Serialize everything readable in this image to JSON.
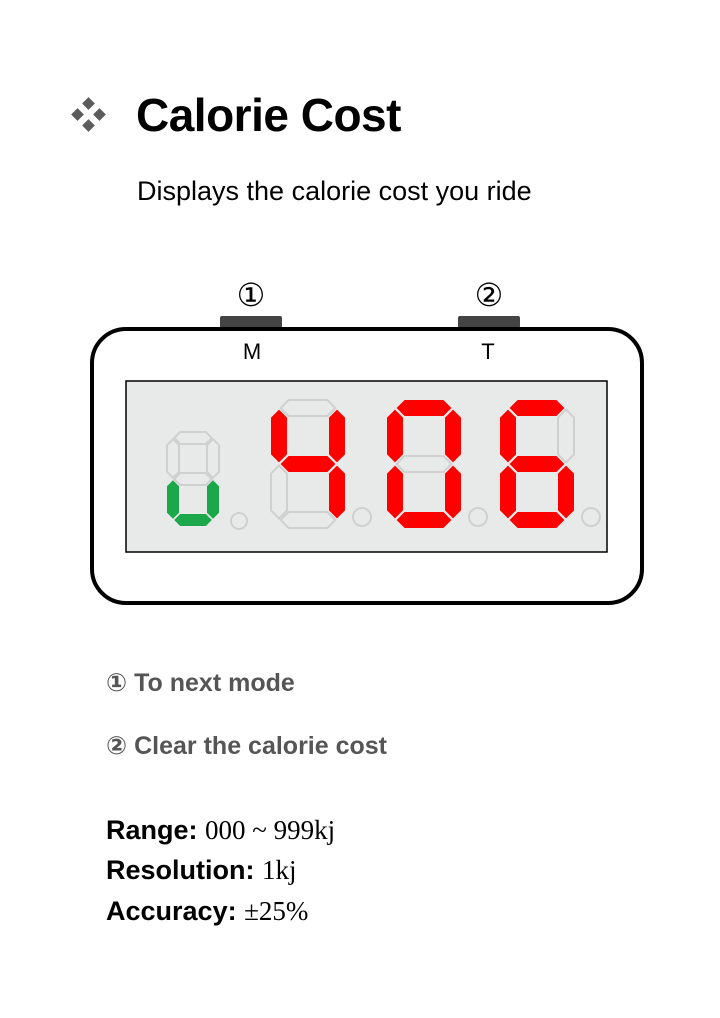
{
  "title": "Calorie Cost",
  "subtitle": "Displays the calorie cost you ride",
  "device": {
    "button1_marker": "①",
    "button1_label": "M",
    "button2_marker": "②",
    "button2_label": "T",
    "display_reading": "406",
    "mode_digit_color": "#1aa84a",
    "value_digit_color": "#ff0000",
    "inactive_segment_color": "#d0d0d0",
    "screen_color": "#e8eaea"
  },
  "descriptions": [
    {
      "marker": "①",
      "text": "To next mode"
    },
    {
      "marker": "②",
      "text": "Clear the calorie cost"
    }
  ],
  "specs": {
    "range_label": "Range:",
    "range_value": "000 ~ 999kj",
    "resolution_label": "Resolution:",
    "resolution_value": "1kj",
    "accuracy_label": "Accuracy:",
    "accuracy_value": "±25%"
  },
  "icons": {
    "bullet": "diamond-cluster-icon"
  }
}
